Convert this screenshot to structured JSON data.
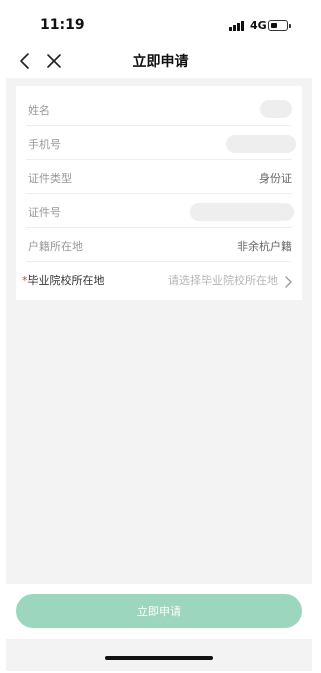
{
  "status_bar": {
    "time": "11:19",
    "network": "4G"
  },
  "nav": {
    "title": "立即申请"
  },
  "form": {
    "rows": [
      {
        "label": "姓名",
        "value": ""
      },
      {
        "label": "手机号",
        "value": ""
      },
      {
        "label": "证件类型",
        "value": "身份证"
      },
      {
        "label": "证件号",
        "value": ""
      },
      {
        "label": "户籍所在地",
        "value": "非余杭户籍"
      },
      {
        "label": "毕业院校所在地",
        "required_mark": "*",
        "placeholder": "请选择毕业院校所在地"
      }
    ]
  },
  "submit": {
    "label": "立即申请"
  },
  "colors": {
    "accent": "#9dd6bf",
    "required": "#e53935",
    "background": "#f3f3f3"
  },
  "icons": [
    "back-icon",
    "close-icon",
    "chevron-right-icon",
    "signal-icon",
    "battery-icon"
  ]
}
